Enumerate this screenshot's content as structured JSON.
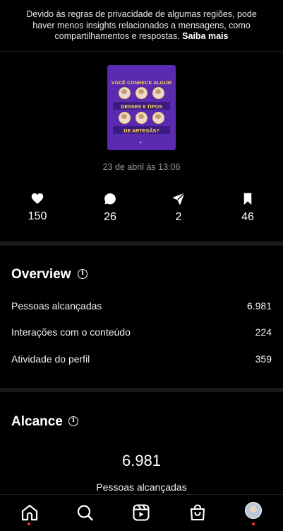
{
  "notice": {
    "text": "Devido às regras de privacidade de algumas regiões, pode haver menos insights relacionados a mensagens, como compartilhamentos e respostas.",
    "link": "Saiba mais"
  },
  "post": {
    "thumb_line1": "VOCÊ CONHECE ALGUM",
    "thumb_line2": "DESSES 6 TIPOS",
    "thumb_line3": "DE ARTESÃS?",
    "date": "23 de abril às 13:06"
  },
  "stats": {
    "likes": "150",
    "comments": "26",
    "shares": "2",
    "saves": "46"
  },
  "overview": {
    "title": "Overview",
    "rows": [
      {
        "label": "Pessoas alcançadas",
        "value": "6.981"
      },
      {
        "label": "Interações com o conteúdo",
        "value": "224"
      },
      {
        "label": "Atividade do perfil",
        "value": "359"
      }
    ]
  },
  "reach": {
    "title": "Alcance",
    "value": "6.981",
    "label": "Pessoas alcançadas"
  },
  "nav": {
    "items": [
      "home-icon",
      "search-icon",
      "reels-icon",
      "shop-icon",
      "profile-avatar"
    ]
  },
  "colors": {
    "background": "#000000",
    "thumb_bg": "#5a2bb0",
    "thumb_text": "#ffd84a",
    "notification_dot": "#ff3040"
  }
}
